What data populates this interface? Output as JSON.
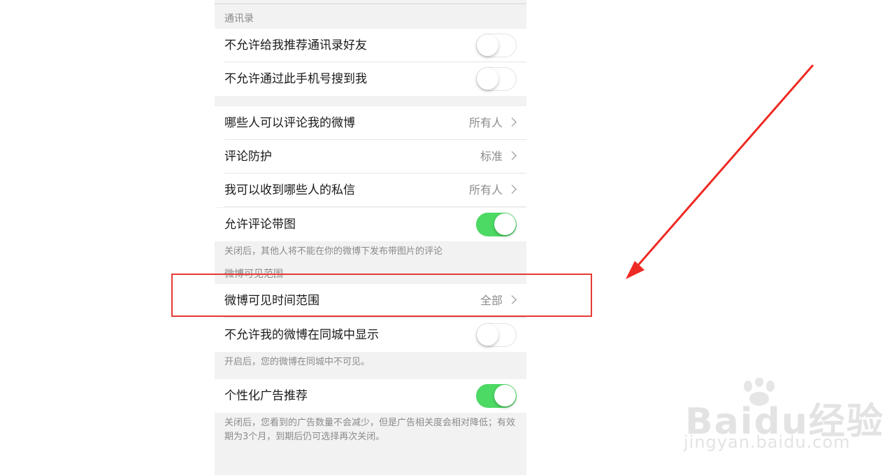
{
  "sections": {
    "contacts_label": "通讯录",
    "visibility_label": "微博可见范围"
  },
  "rows": {
    "no_recommend_contacts": {
      "label": "不允许给我推荐通讯录好友",
      "toggle": "off"
    },
    "no_search_by_phone": {
      "label": "不允许通过此手机号搜到我",
      "toggle": "off"
    },
    "who_can_comment": {
      "label": "哪些人可以评论我的微博",
      "value": "所有人"
    },
    "comment_protection": {
      "label": "评论防护",
      "value": "标准"
    },
    "who_can_message": {
      "label": "我可以收到哪些人的私信",
      "value": "所有人"
    },
    "allow_comment_images": {
      "label": "允许评论带图",
      "toggle": "on"
    },
    "visible_time_range": {
      "label": "微博可见时间范围",
      "value": "全部"
    },
    "hide_in_local_city": {
      "label": "不允许我的微博在同城中显示",
      "toggle": "off"
    },
    "personalized_ads": {
      "label": "个性化广告推荐",
      "toggle": "on"
    }
  },
  "notes": {
    "comment_images_note": "关闭后，其他人将不能在你的微博下发布带图片的评论",
    "local_city_note": "开启后，您的微博在同城中不可见。",
    "ads_note": "关闭后，您看到的广告数量不会减少，但是广告相关度会相对降低；有效期为3个月，到期后仍可选择再次关闭。"
  },
  "watermark": {
    "logo": "Baidu经验",
    "url": "jingyan.baidu.com"
  },
  "colors": {
    "toggle_on": "#4cd964",
    "highlight": "#e53935",
    "background": "#f2f2f2"
  }
}
